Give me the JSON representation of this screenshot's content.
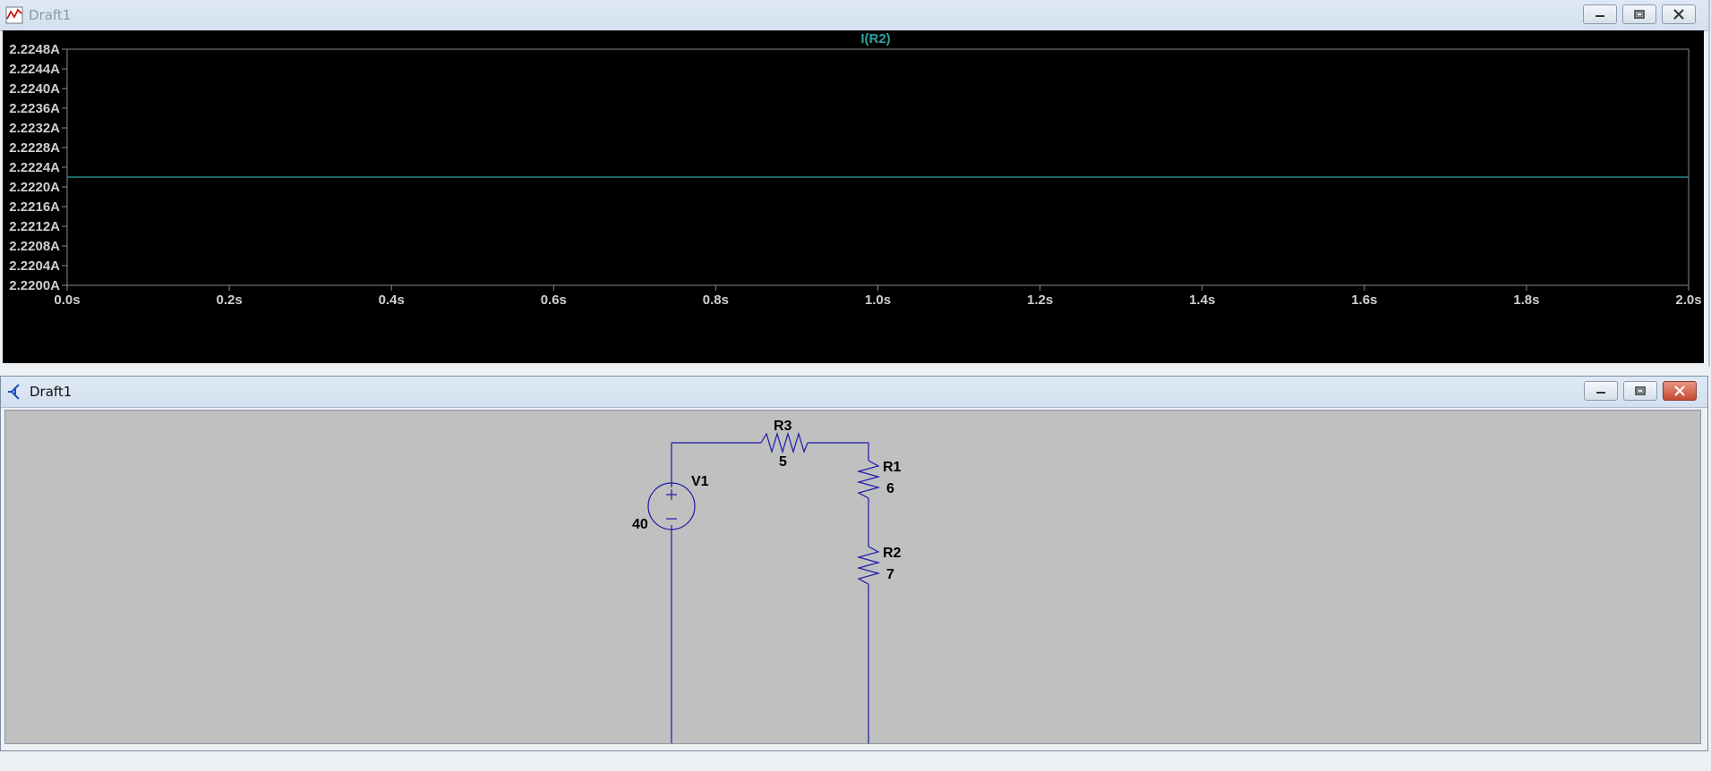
{
  "plot_window": {
    "title": "Draft1",
    "icon": "waveform-icon",
    "buttons": [
      "minimize",
      "restore",
      "close"
    ]
  },
  "schematic_window": {
    "title": "Draft1",
    "icon": "schematic-icon",
    "buttons": [
      "minimize",
      "restore",
      "close"
    ]
  },
  "colors": {
    "trace": "#2aa5a5",
    "wire": "#1a1aa8",
    "axis_text": "#cfcfcf",
    "plot_bg": "#000000",
    "schematic_bg": "#c0c0c0"
  },
  "chart_data": {
    "type": "line",
    "title": "I(R2)",
    "xlabel": "",
    "ylabel": "",
    "xlim": [
      0.0,
      2.0
    ],
    "ylim": [
      2.22,
      2.2248
    ],
    "x_ticks": [
      "0.0s",
      "0.2s",
      "0.4s",
      "0.6s",
      "0.8s",
      "1.0s",
      "1.2s",
      "1.4s",
      "1.6s",
      "1.8s",
      "2.0s"
    ],
    "y_ticks": [
      "2.2248A",
      "2.2244A",
      "2.2240A",
      "2.2236A",
      "2.2232A",
      "2.2228A",
      "2.2224A",
      "2.2220A",
      "2.2216A",
      "2.2212A",
      "2.2208A",
      "2.2204A",
      "2.2200A"
    ],
    "grid": false,
    "series": [
      {
        "name": "I(R2)",
        "x": [
          0.0,
          2.0
        ],
        "y": [
          2.2222,
          2.2222
        ]
      }
    ]
  },
  "schematic": {
    "components": {
      "r3": {
        "name": "R3",
        "value": "5"
      },
      "r1": {
        "name": "R1",
        "value": "6"
      },
      "r2": {
        "name": "R2",
        "value": "7"
      },
      "v1": {
        "name": "V1",
        "value": "40"
      }
    }
  }
}
